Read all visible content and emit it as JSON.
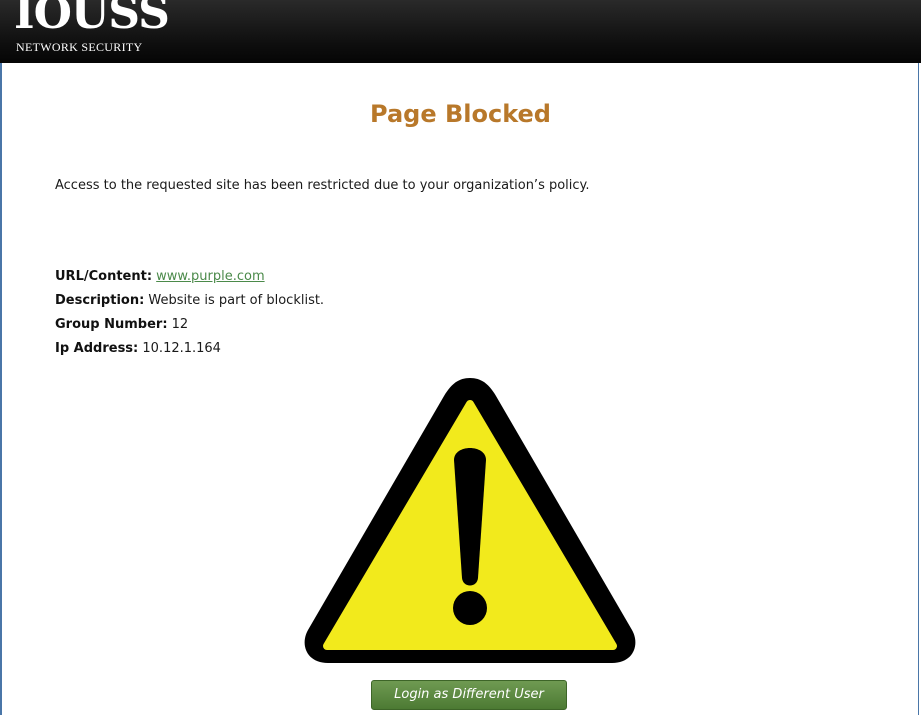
{
  "header": {
    "logo_mark": "IOUSS",
    "logo_sub": "NETWORK SECURITY"
  },
  "page": {
    "title": "Page Blocked",
    "message": "Access to the requested site has been restricted due to your organization’s policy."
  },
  "details": {
    "url_label": "URL/Content:",
    "url_value": "www.purple.com",
    "description_label": "Description:",
    "description_value": "Website is part of blocklist.",
    "group_label": "Group Number:",
    "group_value": "12",
    "ip_label": "Ip Address:",
    "ip_value": "10.12.1.164"
  },
  "warning_icon": "warning-triangle-exclamation",
  "login_button": "Login as Different User",
  "colors": {
    "title": "#b8782a",
    "link": "#4b8a4a",
    "button": "#5a8a3e",
    "warning_fill": "#f2ea1c",
    "header": "#0e0e0e"
  }
}
